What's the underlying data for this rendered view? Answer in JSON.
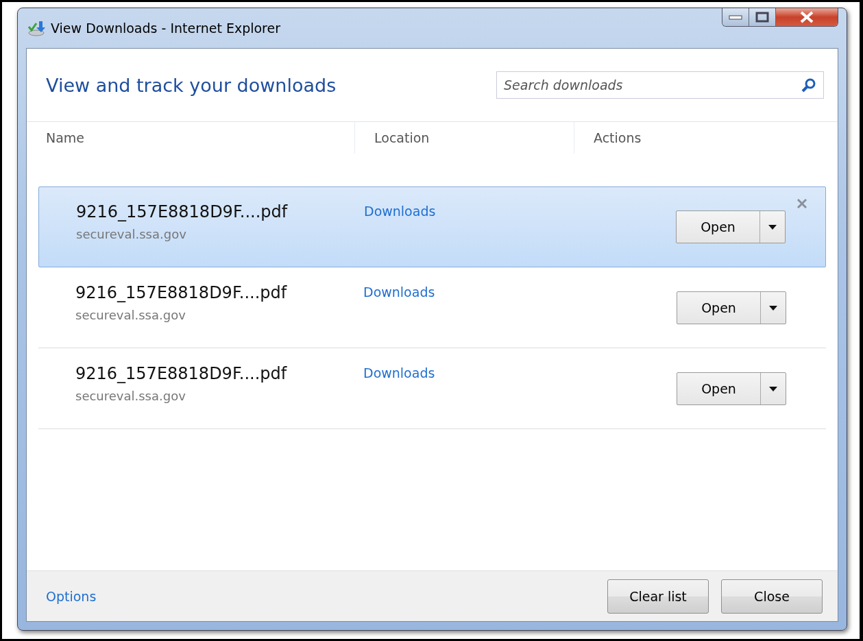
{
  "window": {
    "title": "View Downloads - Internet Explorer"
  },
  "heading": "View and track your downloads",
  "search": {
    "placeholder": "Search downloads"
  },
  "columns": [
    "Name",
    "Location",
    "Actions"
  ],
  "downloads": [
    {
      "name": "9216_157E8818D9F....pdf",
      "source": "secureval.ssa.gov",
      "location": "Downloads",
      "action": "Open",
      "selected": true
    },
    {
      "name": "9216_157E8818D9F....pdf",
      "source": "secureval.ssa.gov",
      "location": "Downloads",
      "action": "Open",
      "selected": false
    },
    {
      "name": "9216_157E8818D9F....pdf",
      "source": "secureval.ssa.gov",
      "location": "Downloads",
      "action": "Open",
      "selected": false
    }
  ],
  "footer": {
    "link": "Options",
    "buttons": [
      "Clear list",
      "Close"
    ]
  }
}
